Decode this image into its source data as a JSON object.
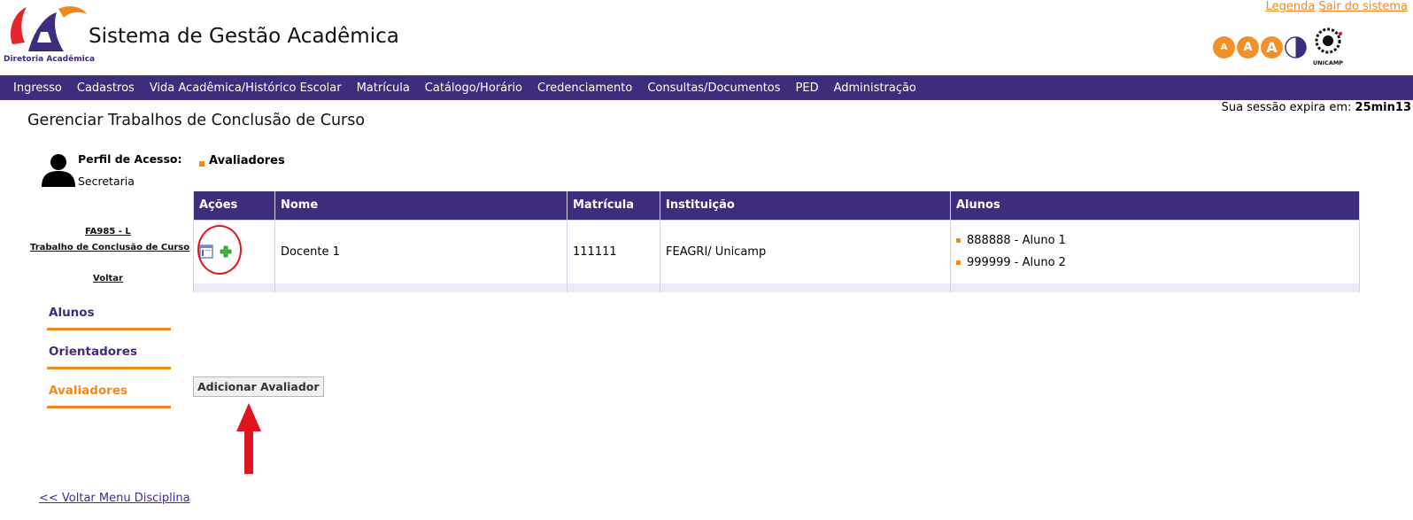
{
  "header": {
    "logo_caption": "Diretoria Acadêmica",
    "app_title": "Sistema de Gestão Acadêmica",
    "links": {
      "legend": "Legenda",
      "logout": "Sair do sistema"
    },
    "font_buttons": [
      "A",
      "A",
      "A"
    ],
    "partner_logo_text": "UNICAMP"
  },
  "nav": {
    "items": [
      "Ingresso",
      "Cadastros",
      "Vida Acadêmica/Histórico Escolar",
      "Matrícula",
      "Catálogo/Horário",
      "Credenciamento",
      "Consultas/Documentos",
      "PED",
      "Administração"
    ]
  },
  "session": {
    "label": "Sua sessão expira em:",
    "time": "25min13"
  },
  "page_title": "Gerenciar Trabalhos de Conclusão de Curso",
  "profile": {
    "label": "Perfil de Acesso:",
    "value": "Secretaria"
  },
  "course": {
    "code": "FA985 - L",
    "name": "Trabalho de Conclusão de Curso",
    "back": "Voltar"
  },
  "side_tabs": {
    "alunos": "Alunos",
    "orientadores": "Orientadores",
    "avaliadores": "Avaliadores"
  },
  "section": {
    "title": "Avaliadores"
  },
  "table": {
    "headers": [
      "Ações",
      "Nome",
      "Matrícula",
      "Instituição",
      "Alunos"
    ],
    "rows": [
      {
        "nome": "Docente 1",
        "matricula": "111111",
        "instituicao": "FEAGRI/ Unicamp",
        "alunos": [
          "888888 - Aluno 1",
          "999999 - Aluno 2"
        ]
      }
    ]
  },
  "add_button": "Adicionar Avaliador",
  "footer_link": "<< Voltar Menu Disciplina",
  "colors": {
    "primary": "#3e2d7d",
    "accent": "#f08a1d",
    "annotation": "#e0141e"
  }
}
